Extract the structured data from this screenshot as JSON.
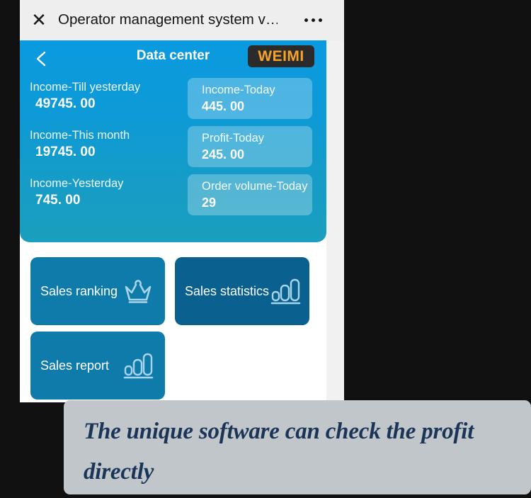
{
  "window": {
    "title": "Operator management system v…",
    "close_icon": "close-icon",
    "more_icon": "more-menu-icon"
  },
  "nav": {
    "back_icon": "chevron-left-icon",
    "title": "Data center",
    "brand": "WEIMI",
    "brand_bg": "#2b2b2b",
    "brand_color": "#f7a32b"
  },
  "hero": {
    "gradient_from": "#0a9ae0",
    "gradient_to": "#1a9fbe",
    "stats_plain": [
      {
        "label": "Income-Till yesterday",
        "value": "49745. 00"
      },
      {
        "label": "Income-This month",
        "value": "19745. 00"
      },
      {
        "label": "Income-Yesterday",
        "value": "745. 00"
      }
    ],
    "stats_cards": [
      {
        "label": "Income-Today",
        "value": "445. 00"
      },
      {
        "label": "Profit-Today",
        "value": "245. 00"
      },
      {
        "label": "Order volume-Today",
        "value": "29"
      }
    ]
  },
  "actions": [
    {
      "label": "Sales ranking",
      "icon": "crown-icon",
      "color": "#0f7bab"
    },
    {
      "label": "Sales statistics",
      "icon": "bar-chart-icon",
      "color": "#0a618f"
    },
    {
      "label": "Sales report",
      "icon": "bar-chart-icon",
      "color": "#0f7bab"
    }
  ],
  "caption": {
    "text": "The unique software can check the profit directly",
    "bg": "#c1c6cb",
    "color": "#1b3557"
  }
}
